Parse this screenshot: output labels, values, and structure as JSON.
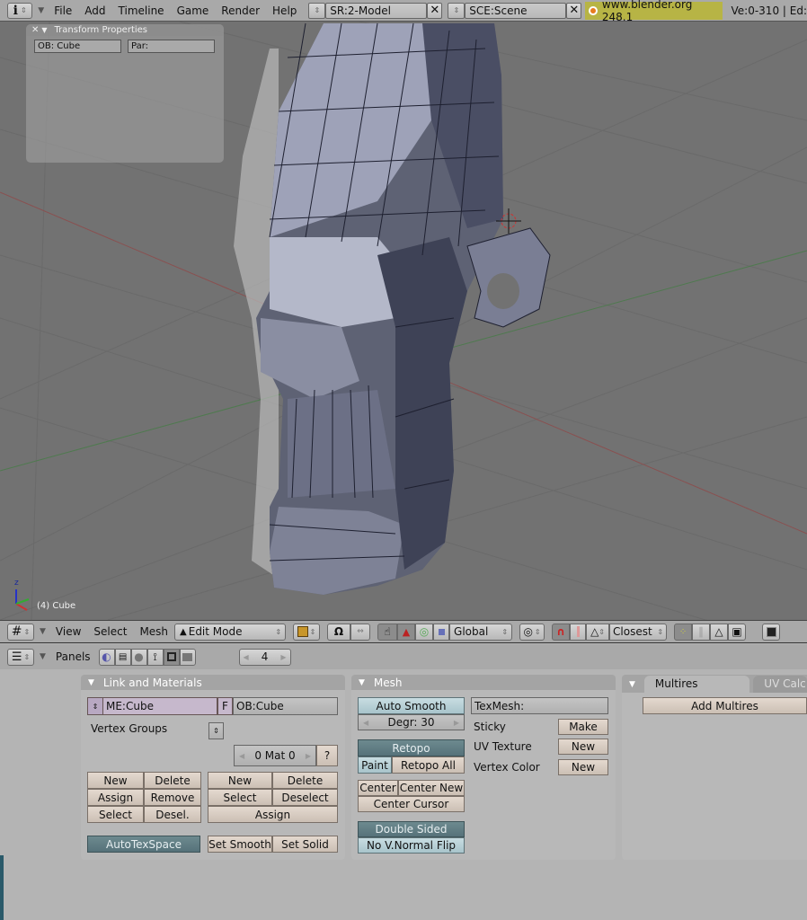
{
  "top_header": {
    "info_icon": "info-icon",
    "menus": [
      "File",
      "Add",
      "Timeline",
      "Game",
      "Render",
      "Help"
    ],
    "screen": "SR:2-Model",
    "scene": "SCE:Scene",
    "version": "www.blender.org 248.1",
    "stats": "Ve:0-310 | Ed:"
  },
  "viewport": {
    "transform_panel": {
      "title": "Transform Properties",
      "object_field": "OB: Cube",
      "parent_field": "Par:"
    },
    "object_label": "(4) Cube",
    "axis_label": "z"
  },
  "view3d_header": {
    "menus": [
      "View",
      "Select",
      "Mesh"
    ],
    "mode": "Edit Mode",
    "orientation": "Global",
    "snap_mode": "Closest"
  },
  "buttons_header": {
    "panels_label": "Panels",
    "frame": "4"
  },
  "link_materials": {
    "title": "Link and Materials",
    "mesh_name": "ME:Cube",
    "fake_user": "F",
    "object_name": "OB:Cube",
    "vertex_groups_label": "Vertex Groups",
    "material_index": "0 Mat 0",
    "help": "?",
    "vgroup_buttons": [
      "New",
      "Delete",
      "Assign",
      "Remove",
      "Select",
      "Desel."
    ],
    "material_buttons": [
      "New",
      "Delete",
      "Select",
      "Deselect",
      "Assign"
    ],
    "autotexspace": "AutoTexSpace",
    "set_smooth": "Set Smooth",
    "set_solid": "Set Solid"
  },
  "mesh": {
    "title": "Mesh",
    "auto_smooth": "Auto Smooth",
    "degree": "Degr: 30",
    "retopo": "Retopo",
    "paint": "Paint",
    "retopo_all": "Retopo All",
    "center": "Center",
    "center_new": "Center New",
    "center_cursor": "Center Cursor",
    "double_sided": "Double Sided",
    "no_vnormal_flip": "No V.Normal Flip",
    "texmesh": "TexMesh:",
    "sticky": "Sticky",
    "sticky_btn": "Make",
    "uv_texture": "UV Texture",
    "uv_btn": "New",
    "vertex_color": "Vertex Color",
    "vc_btn": "New"
  },
  "multires": {
    "tab_active": "Multires",
    "tab_inactive": "UV Calc",
    "add": "Add Multires"
  }
}
